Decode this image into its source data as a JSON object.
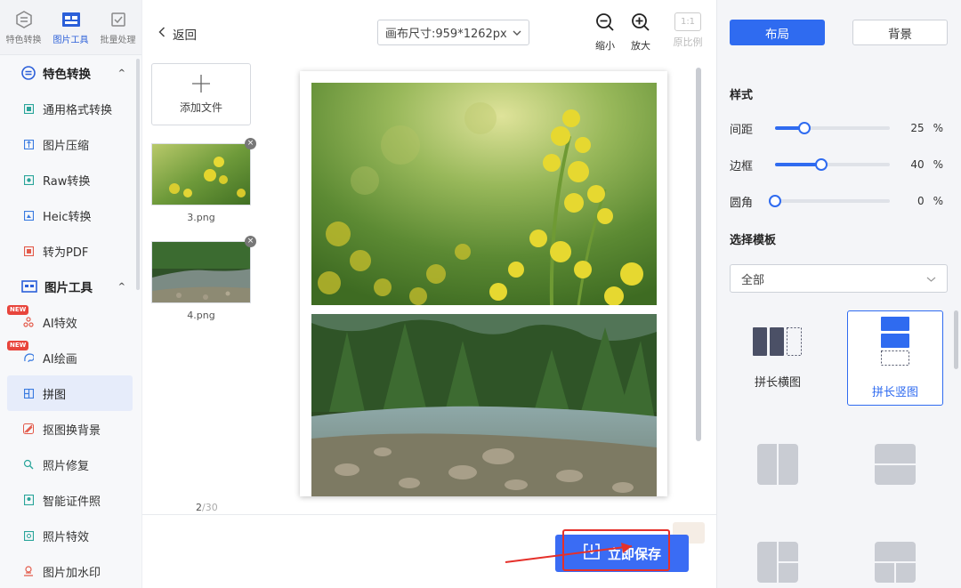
{
  "top_nav": [
    {
      "label": "特色转换",
      "icon": "convert-icon",
      "active": false
    },
    {
      "label": "图片工具",
      "icon": "image-tools-icon",
      "active": true
    },
    {
      "label": "批量处理",
      "icon": "batch-icon",
      "active": false
    }
  ],
  "sidebar": {
    "sections": [
      {
        "title": "特色转换",
        "items": [
          {
            "label": "通用格式转换",
            "icon": "format-convert-icon"
          },
          {
            "label": "图片压缩",
            "icon": "compress-icon"
          },
          {
            "label": "Raw转换",
            "icon": "raw-icon"
          },
          {
            "label": "Heic转换",
            "icon": "heic-icon"
          },
          {
            "label": "转为PDF",
            "icon": "pdf-icon"
          }
        ]
      },
      {
        "title": "图片工具",
        "items": [
          {
            "label": "AI特效",
            "icon": "ai-effect-icon",
            "badge": "NEW"
          },
          {
            "label": "AI绘画",
            "icon": "ai-paint-icon",
            "badge": "NEW"
          },
          {
            "label": "拼图",
            "icon": "collage-icon",
            "active": true
          },
          {
            "label": "抠图换背景",
            "icon": "cutout-icon"
          },
          {
            "label": "照片修复",
            "icon": "repair-icon"
          },
          {
            "label": "智能证件照",
            "icon": "id-photo-icon"
          },
          {
            "label": "照片特效",
            "icon": "photo-effect-icon"
          },
          {
            "label": "图片加水印",
            "icon": "watermark-icon"
          }
        ]
      }
    ]
  },
  "toolbar": {
    "back_label": "返回",
    "canvas_size": "画布尺寸:959*1262px",
    "zoom_out": "缩小",
    "zoom_in": "放大",
    "original_ratio": "原比例",
    "ratio_value": "1:1"
  },
  "files": {
    "add_label": "添加文件",
    "items": [
      {
        "name": "3.png",
        "scene": "flowers"
      },
      {
        "name": "4.png",
        "scene": "river"
      }
    ],
    "page_current": "2",
    "page_total": "/30"
  },
  "save_label": "立即保存",
  "right_panel": {
    "tab_layout": "布局",
    "tab_background": "背景",
    "style_heading": "样式",
    "sliders": [
      {
        "label": "间距",
        "value": "25",
        "unit": "%",
        "fraction": 0.25
      },
      {
        "label": "边框",
        "value": "40",
        "unit": "%",
        "fraction": 0.4
      },
      {
        "label": "圆角",
        "value": "0",
        "unit": "%",
        "fraction": 0.0
      }
    ],
    "template_heading": "选择模板",
    "template_filter": "全部",
    "templates": [
      {
        "label": "拼长横图",
        "selected": false
      },
      {
        "label": "拼长竖图",
        "selected": true
      }
    ]
  },
  "colors": {
    "accent": "#2f6bf0",
    "save_button": "#3a6cf4",
    "highlight": "#e5302a",
    "badge": "#e8453c"
  }
}
